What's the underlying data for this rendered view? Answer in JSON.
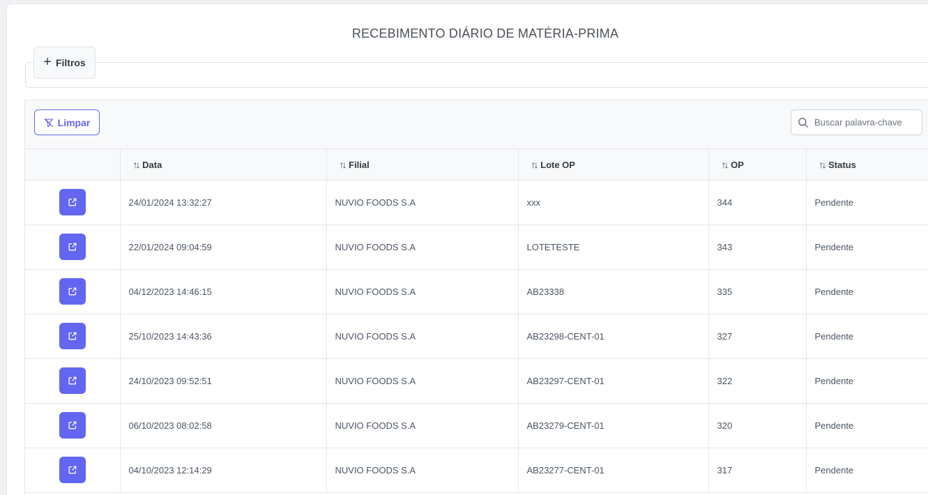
{
  "page": {
    "title": "RECEBIMENTO DIÁRIO DE MATÉRIA-PRIMA"
  },
  "filters": {
    "button_label": "Filtros"
  },
  "toolbar": {
    "clear_label": "Limpar",
    "search_placeholder": "Buscar palavra-chave"
  },
  "table": {
    "columns": [
      "",
      "Data",
      "Filial",
      "Lote OP",
      "OP",
      "Status"
    ],
    "sort_glyph": "↑↓",
    "rows": [
      {
        "data": "24/01/2024 13:32:27",
        "filial": "NUVIO FOODS S.A",
        "lote_op": "xxx",
        "op": "344",
        "status": "Pendente"
      },
      {
        "data": "22/01/2024 09:04:59",
        "filial": "NUVIO FOODS S.A",
        "lote_op": "LOTETESTE",
        "op": "343",
        "status": "Pendente"
      },
      {
        "data": "04/12/2023 14:46:15",
        "filial": "NUVIO FOODS S.A",
        "lote_op": "AB23338",
        "op": "335",
        "status": "Pendente"
      },
      {
        "data": "25/10/2023 14:43:36",
        "filial": "NUVIO FOODS S.A",
        "lote_op": "AB23298-CENT-01",
        "op": "327",
        "status": "Pendente"
      },
      {
        "data": "24/10/2023 09:52:51",
        "filial": "NUVIO FOODS S.A",
        "lote_op": "AB23297-CENT-01",
        "op": "322",
        "status": "Pendente"
      },
      {
        "data": "06/10/2023 08:02:58",
        "filial": "NUVIO FOODS S.A",
        "lote_op": "AB23279-CENT-01",
        "op": "320",
        "status": "Pendente"
      },
      {
        "data": "04/10/2023 12:14:29",
        "filial": "NUVIO FOODS S.A",
        "lote_op": "AB23277-CENT-01",
        "op": "317",
        "status": "Pendente"
      }
    ]
  },
  "colors": {
    "accent": "#6366f1",
    "background": "#eff1f4",
    "card": "#ffffff"
  },
  "icons": {
    "filter_add": "plus-icon",
    "clear": "filter-slash-icon",
    "search": "search-icon",
    "row_action": "external-link-icon"
  }
}
